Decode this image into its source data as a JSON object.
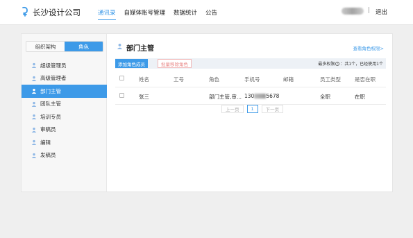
{
  "header": {
    "brand": "长沙设计公司",
    "nav": [
      {
        "label": "通讯录",
        "active": true
      },
      {
        "label": "自媒体账号管理",
        "active": false
      },
      {
        "label": "数据统计",
        "active": false
      },
      {
        "label": "公告",
        "active": false
      }
    ],
    "separator": "|",
    "logout": "退出"
  },
  "sidebar": {
    "tabs": [
      {
        "label": "组织架构",
        "active": false
      },
      {
        "label": "角色",
        "active": true
      }
    ],
    "items": [
      {
        "label": "超级管理员",
        "active": false
      },
      {
        "label": "高级管理者",
        "active": false
      },
      {
        "label": "部门主管",
        "active": true
      },
      {
        "label": "团队主管",
        "active": false
      },
      {
        "label": "培训专员",
        "active": false
      },
      {
        "label": "审稿员",
        "active": false
      },
      {
        "label": "编辑",
        "active": false
      },
      {
        "label": "发稿员",
        "active": false
      }
    ]
  },
  "main": {
    "title": "部门主管",
    "permissions_link": "查看角色权限>",
    "add_button": "添加角色成员",
    "remove_button": "批量移除角色",
    "limit_label": "最多权限",
    "limit_text": "：共1个，已经使用1个",
    "table": {
      "columns": [
        "姓名",
        "工号",
        "角色",
        "手机号",
        "邮箱",
        "员工类型",
        "是否在职"
      ],
      "rows": [
        {
          "name": "张三",
          "id": "",
          "role": "部门主管,审...",
          "phone_prefix": "130",
          "phone_suffix": "5678",
          "email": "",
          "type": "全职",
          "status": "在职"
        }
      ]
    },
    "pagination": {
      "prev": "上一页",
      "current": "1",
      "next": "下一页"
    }
  },
  "colors": {
    "accent": "#3d9ae8",
    "danger": "#e88a8a"
  }
}
